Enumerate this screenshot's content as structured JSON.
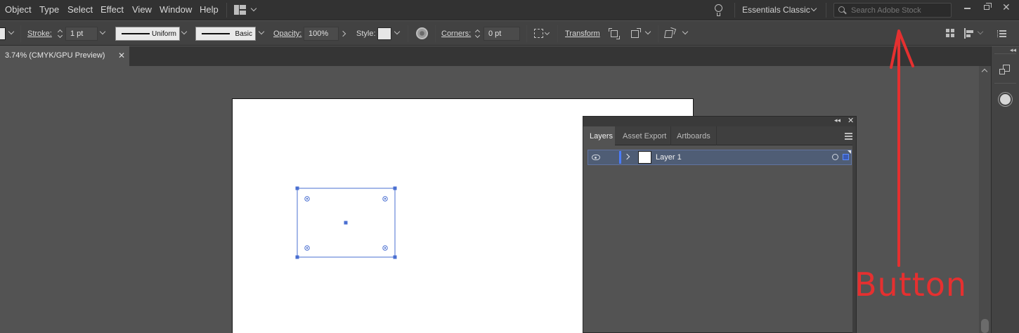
{
  "menubar": {
    "items": [
      "Object",
      "Type",
      "Select",
      "Effect",
      "View",
      "Window",
      "Help"
    ],
    "workspace": "Essentials Classic",
    "search_placeholder": "Search Adobe Stock"
  },
  "controlbar": {
    "stroke_label": "Stroke:",
    "stroke_weight": "1 pt",
    "profile_label": "Uniform",
    "brush_label": "Basic",
    "opacity_label": "Opacity:",
    "opacity_value": "100%",
    "style_label": "Style:",
    "corners_label": "Corners:",
    "corners_value": "0 pt",
    "transform_label": "Transform"
  },
  "document": {
    "tab_title": "3.74% (CMYK/GPU Preview)",
    "close_glyph": "✕"
  },
  "layers_panel": {
    "tabs": [
      "Layers",
      "Asset Export",
      "Artboards"
    ],
    "active_tab": "Layers",
    "layers": [
      {
        "name": "Layer 1",
        "color": "#4a7cff",
        "visible": true,
        "selected": true
      }
    ]
  },
  "annotation": {
    "text": "Button",
    "color": "#e53030"
  },
  "colors": {
    "app_bg": "#535353",
    "menubar_bg": "#323232",
    "control_bg": "#424242",
    "selection": "#4a6fd1"
  }
}
